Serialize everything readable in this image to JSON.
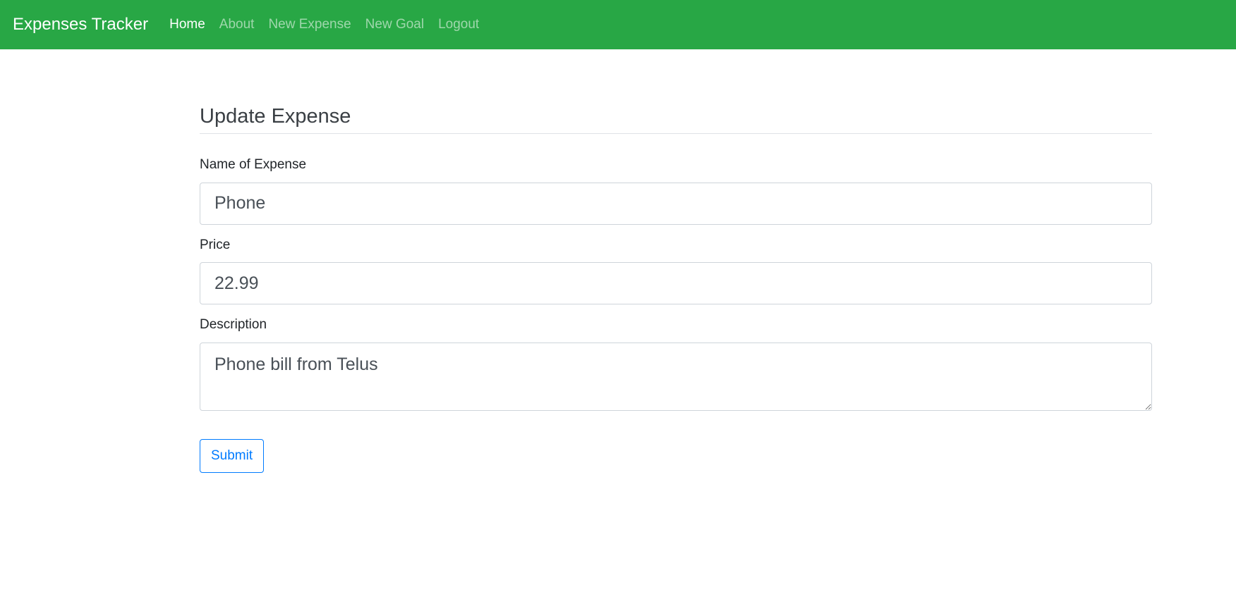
{
  "navbar": {
    "brand": "Expenses Tracker",
    "links": [
      {
        "label": "Home",
        "active": true
      },
      {
        "label": "About",
        "active": false
      },
      {
        "label": "New Expense",
        "active": false
      },
      {
        "label": "New Goal",
        "active": false
      },
      {
        "label": "Logout",
        "active": false
      }
    ],
    "bg_color": "#28a745"
  },
  "form": {
    "title": "Update Expense",
    "name_label": "Name of Expense",
    "name_value": "Phone",
    "price_label": "Price",
    "price_value": "22.99",
    "description_label": "Description",
    "description_value": "Phone bill from Telus",
    "submit_label": "Submit"
  }
}
